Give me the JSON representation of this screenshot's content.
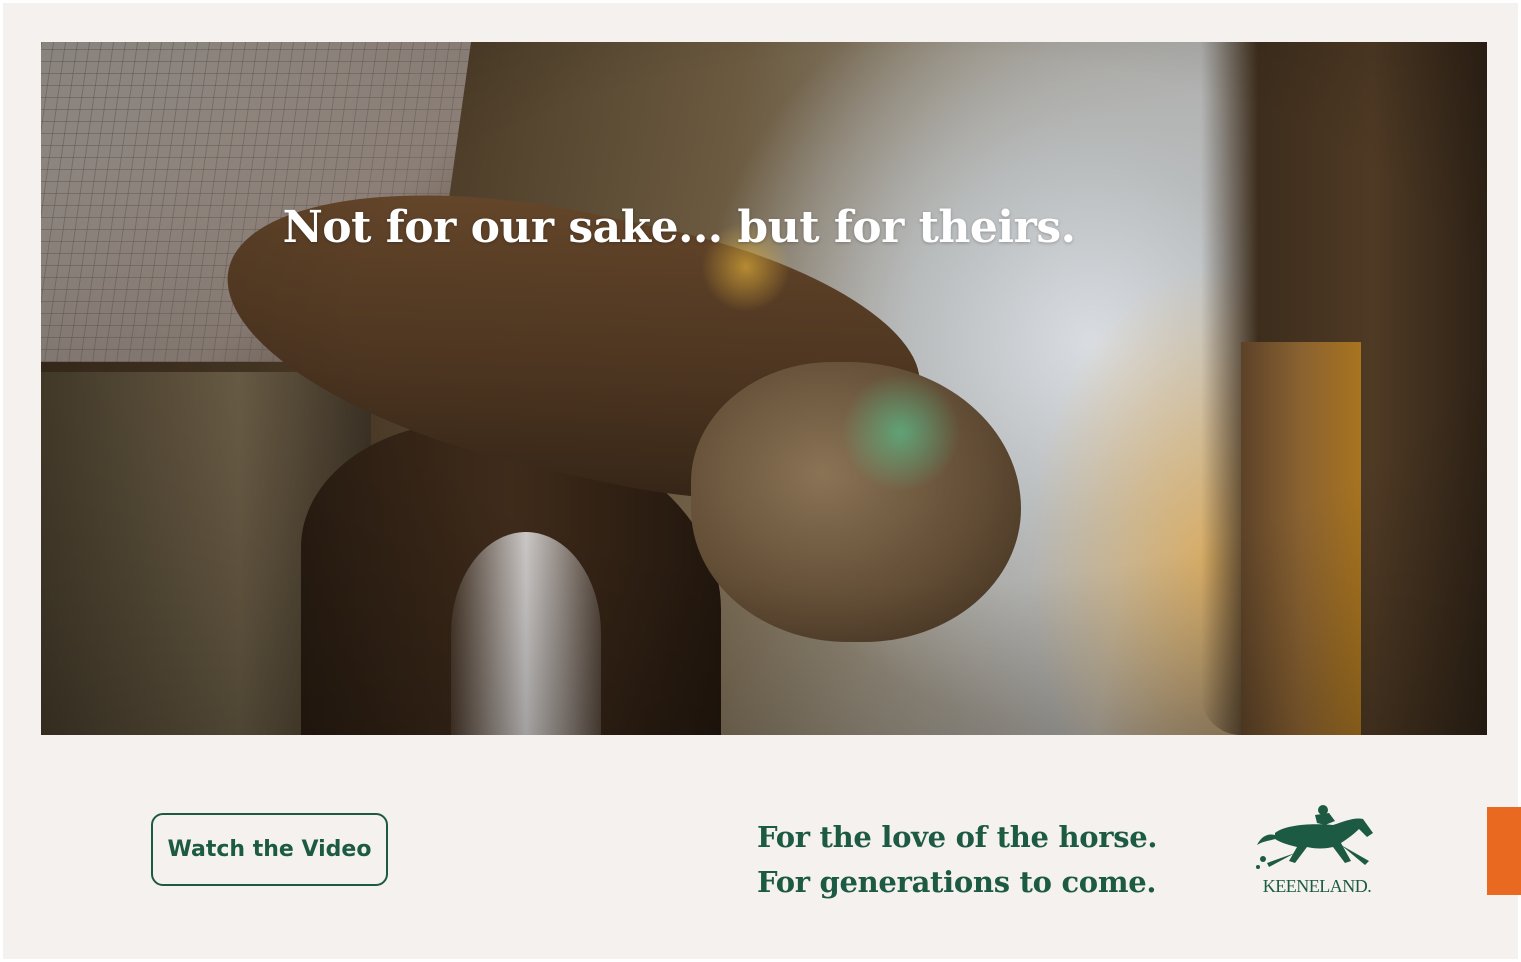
{
  "hero": {
    "headline": "Not for our sake... but for theirs."
  },
  "cta": {
    "watch_label": "Watch the Video"
  },
  "tagline": {
    "line1": "For the love of the horse.",
    "line2": "For generations to come."
  },
  "brand": {
    "name": "KEENELAND."
  },
  "colors": {
    "brand_green": "#1d5a43",
    "accent_orange": "#e8691f",
    "background": "#f4f1ee"
  }
}
